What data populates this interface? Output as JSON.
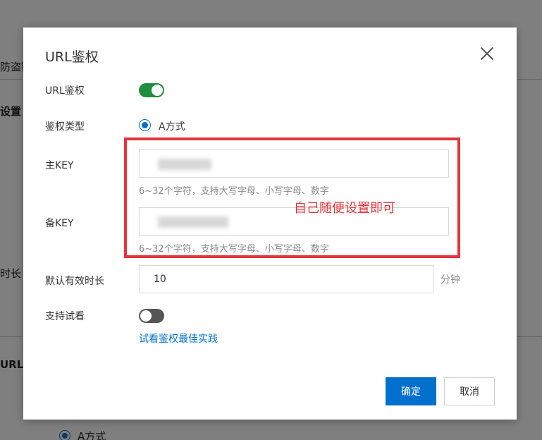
{
  "background": {
    "tab_fragment": "防盗链",
    "section_fragment": "设置",
    "row_fragment": "时长",
    "section2_fragment": "URL",
    "radio_label": "A方式"
  },
  "dialog": {
    "title": "URL鉴权",
    "fields": {
      "url_auth_label": "URL鉴权",
      "url_auth_enabled": true,
      "auth_type_label": "鉴权类型",
      "auth_type_option": "A方式",
      "primary_key_label": "主KEY",
      "primary_key_hint": "6~32个字符，支持大写字母、小写字母、数字",
      "backup_key_label": "备KEY",
      "backup_key_hint": "6~32个字符，支持大写字母、小写字母、数字",
      "duration_label": "默认有效时长",
      "duration_value": "10",
      "duration_unit": "分钟",
      "trial_label": "支持试看",
      "trial_enabled": false,
      "trial_link": "试看鉴权最佳实践"
    },
    "annotation": "自己随便设置即可",
    "buttons": {
      "confirm": "确定",
      "cancel": "取消"
    },
    "colors": {
      "primary": "#0070cc",
      "toggle_on": "#1e8e3e",
      "annotation": "#e8333c"
    }
  }
}
